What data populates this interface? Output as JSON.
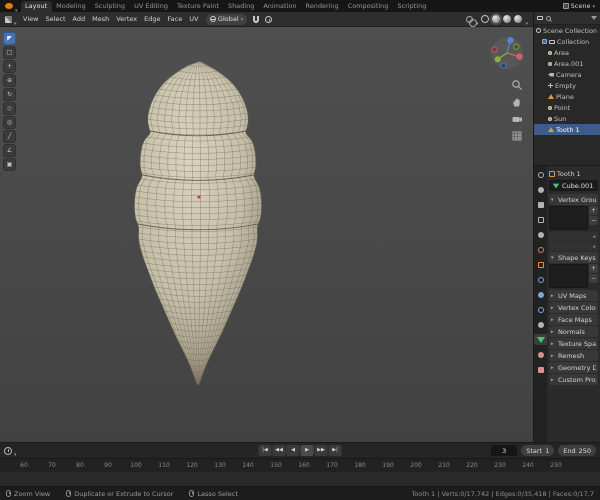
{
  "colors": {
    "accent": "#4772b3",
    "selection": "#3e5c8a",
    "object_orange": "#e8913a",
    "data_green": "#44c57c",
    "axis_x": "#d0616b",
    "axis_y": "#85b43e",
    "axis_z": "#5385d0",
    "mesh_base": "#c6bfa9"
  },
  "topbar": {
    "tabs": [
      {
        "label": "Layout",
        "active": true
      },
      {
        "label": "Modeling",
        "active": false
      },
      {
        "label": "Sculpting",
        "active": false
      },
      {
        "label": "UV Editing",
        "active": false
      },
      {
        "label": "Texture Paint",
        "active": false
      },
      {
        "label": "Shading",
        "active": false
      },
      {
        "label": "Animation",
        "active": false
      },
      {
        "label": "Rendering",
        "active": false
      },
      {
        "label": "Compositing",
        "active": false
      },
      {
        "label": "Scripting",
        "active": false
      }
    ],
    "scene_selector": "Scene"
  },
  "viewport_header": {
    "menus": [
      "View",
      "Select",
      "Add",
      "Mesh",
      "Vertex",
      "Edge",
      "Face",
      "UV"
    ],
    "orientation": "Global"
  },
  "viewport_tools": [
    "tweak",
    "select-box",
    "cursor",
    "move",
    "rotate",
    "scale",
    "transform",
    "annotate",
    "measure",
    "add-cube"
  ],
  "outliner": {
    "rows": [
      {
        "label": "Scene Collection",
        "depth": 0,
        "icon": "scene",
        "selected": false,
        "checkbox": false
      },
      {
        "label": "Collection",
        "depth": 1,
        "icon": "collection",
        "selected": false,
        "checkbox": true
      },
      {
        "label": "Area",
        "depth": 2,
        "icon": "light",
        "selected": false,
        "checkbox": false
      },
      {
        "label": "Area.001",
        "depth": 2,
        "icon": "light",
        "selected": false,
        "checkbox": false
      },
      {
        "label": "Camera",
        "depth": 2,
        "icon": "camera",
        "selected": false,
        "checkbox": false
      },
      {
        "label": "Empty",
        "depth": 2,
        "icon": "empty",
        "selected": false,
        "checkbox": false
      },
      {
        "label": "Plane",
        "depth": 2,
        "icon": "mesh",
        "selected": false,
        "checkbox": false
      },
      {
        "label": "Point",
        "depth": 2,
        "icon": "light",
        "selected": false,
        "checkbox": false
      },
      {
        "label": "Sun",
        "depth": 2,
        "icon": "light",
        "selected": false,
        "checkbox": false
      },
      {
        "label": "Tooth 1",
        "depth": 2,
        "icon": "mesh",
        "selected": true,
        "checkbox": false
      }
    ]
  },
  "properties": {
    "breadcrumb_object": "Tooth 1",
    "mesh_name": "Cube.001",
    "tabs": [
      {
        "name": "tool",
        "shape": "ring",
        "color": "#b4b4b4",
        "active": false
      },
      {
        "name": "render",
        "shape": "circle",
        "color": "#b4b4b4",
        "active": false
      },
      {
        "name": "output",
        "shape": "square",
        "color": "#b4b4b4",
        "active": false
      },
      {
        "name": "view-layer",
        "shape": "square-outline",
        "color": "#b4b4b4",
        "active": false
      },
      {
        "name": "scene",
        "shape": "circle",
        "color": "#b4b4b4",
        "active": false
      },
      {
        "name": "world",
        "shape": "ring",
        "color": "#c9826a",
        "active": false
      },
      {
        "name": "object",
        "shape": "square-outline",
        "color": "#e8913a",
        "active": false
      },
      {
        "name": "modifiers",
        "shape": "ring",
        "color": "#7aa7d6",
        "active": false
      },
      {
        "name": "particles",
        "shape": "circle",
        "color": "#7aa7d6",
        "active": false
      },
      {
        "name": "physics",
        "shape": "ring",
        "color": "#7aa7d6",
        "active": false
      },
      {
        "name": "constraints",
        "shape": "circle",
        "color": "#b4b4b4",
        "active": false
      },
      {
        "name": "object-data",
        "shape": "triangle",
        "color": "#44c57c",
        "active": true
      },
      {
        "name": "material",
        "shape": "circle",
        "color": "#d98f8f",
        "active": false
      },
      {
        "name": "texture",
        "shape": "square",
        "color": "#d98f8f",
        "active": false
      }
    ],
    "sections": [
      {
        "label": "Vertex Groups",
        "name": "vertex-groups",
        "expanded": true,
        "kind": "list",
        "extra_rows": 2
      },
      {
        "label": "Shape Keys",
        "name": "shape-keys",
        "expanded": true,
        "kind": "list",
        "extra_rows": 0
      },
      {
        "label": "UV Maps",
        "name": "uv-maps",
        "expanded": false
      },
      {
        "label": "Vertex Colors",
        "name": "vertex-colors",
        "expanded": false
      },
      {
        "label": "Face Maps",
        "name": "face-maps",
        "expanded": false
      },
      {
        "label": "Normals",
        "name": "normals",
        "expanded": false
      },
      {
        "label": "Texture Space",
        "name": "texture-space",
        "expanded": false
      },
      {
        "label": "Remesh",
        "name": "remesh",
        "expanded": false
      },
      {
        "label": "Geometry Data",
        "name": "geometry-data",
        "expanded": false
      },
      {
        "label": "Custom Properties",
        "name": "custom-properties",
        "expanded": false
      }
    ]
  },
  "timeline": {
    "current_frame": "3",
    "start": {
      "label": "Start",
      "value": "1"
    },
    "end": {
      "label": "End",
      "value": "250"
    },
    "playback": [
      "jump-to-start",
      "prev-keyframe",
      "play-reverse",
      "play",
      "next-keyframe",
      "jump-to-end"
    ],
    "ruler_numbers": [
      "60",
      "70",
      "80",
      "90",
      "100",
      "110",
      "120",
      "130",
      "140",
      "150",
      "160",
      "170",
      "180",
      "190",
      "200",
      "210",
      "220",
      "230",
      "240",
      "250"
    ]
  },
  "statusbar": {
    "hints": [
      "Zoom View",
      "Duplicate or Extrude to Cursor",
      "Lasso Select"
    ],
    "stats": "Tooth 1 | Verts:0/17,742 | Edges:0/35,418 | Faces:0/17,7"
  }
}
